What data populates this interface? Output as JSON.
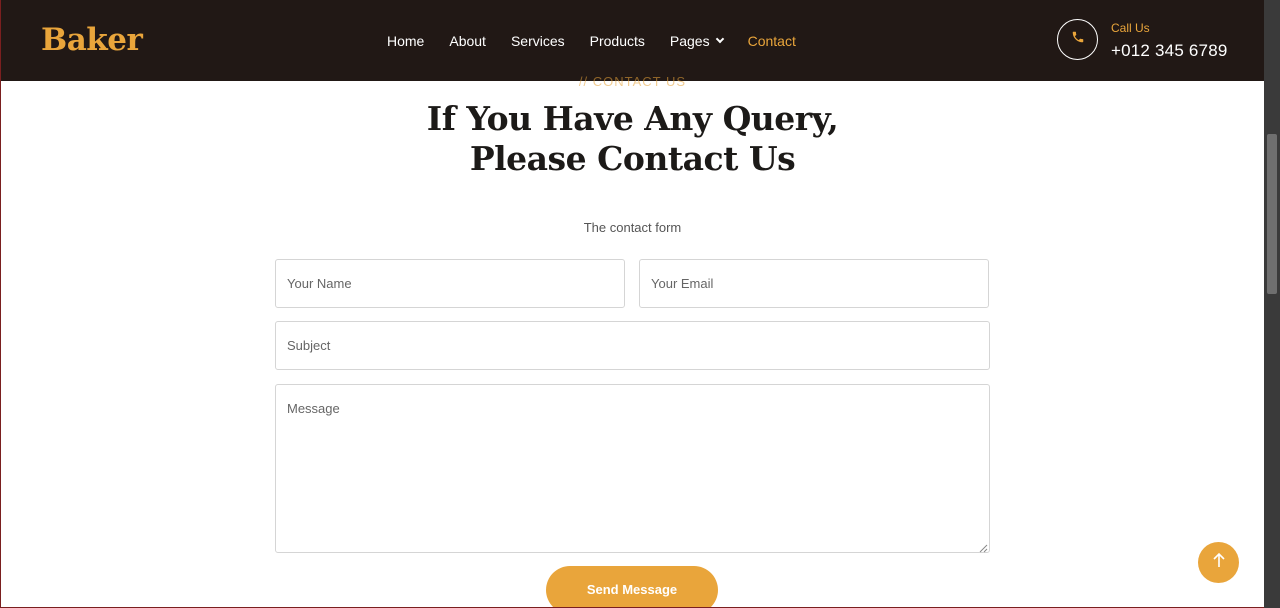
{
  "brand": {
    "name": "Baker",
    "color": "#e9a53b"
  },
  "nav": {
    "items": [
      {
        "label": "Home"
      },
      {
        "label": "About"
      },
      {
        "label": "Services"
      },
      {
        "label": "Products"
      },
      {
        "label": "Pages"
      },
      {
        "label": "Contact"
      }
    ],
    "active": "Contact"
  },
  "call": {
    "label": "Call Us",
    "number": "+012 345 6789",
    "icon": "phone-icon"
  },
  "section": {
    "eyebrow": "// CONTACT US",
    "title_line1": "If You Have Any Query,",
    "title_line2": "Please Contact Us",
    "subtext": "The contact form"
  },
  "form": {
    "name_placeholder": "Your Name",
    "email_placeholder": "Your Email",
    "subject_placeholder": "Subject",
    "message_placeholder": "Message",
    "submit_label": "Send Message"
  },
  "back_to_top": {
    "icon": "arrow-up-icon"
  },
  "colors": {
    "accent": "#e9a53b",
    "navbar_bg": "#211815",
    "heading": "#1c1a18"
  }
}
